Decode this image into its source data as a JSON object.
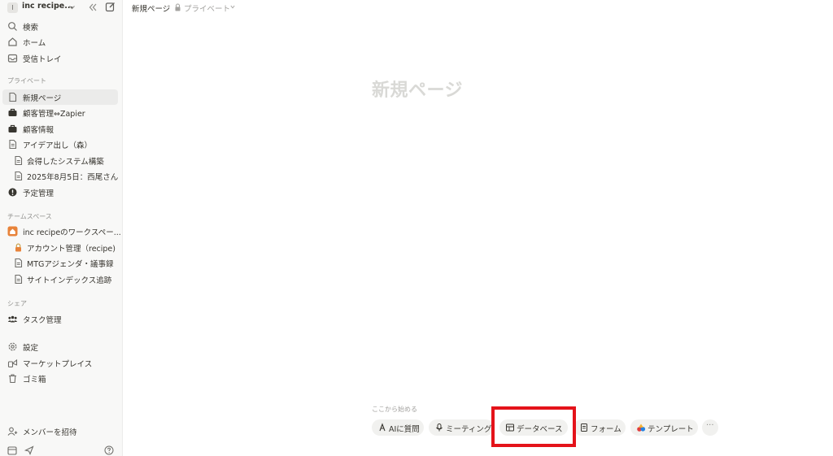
{
  "workspace": {
    "badge": "I",
    "name": "inc recipe..."
  },
  "sidebar": {
    "top_items": [
      {
        "label": "検索",
        "icon": "search-icon"
      },
      {
        "label": "ホーム",
        "icon": "home-icon"
      },
      {
        "label": "受信トレイ",
        "icon": "inbox-icon"
      }
    ],
    "private_label": "プライベート",
    "private_items": [
      {
        "label": "新規ページ",
        "icon": "page-icon"
      },
      {
        "label": "顧客管理⇔Zapier",
        "icon": "briefcase-icon"
      },
      {
        "label": "顧客情報",
        "icon": "briefcase-icon"
      },
      {
        "label": "アイデア出し（森）",
        "icon": "page-icon"
      },
      {
        "label": "会得したシステム構築",
        "icon": "page-icon"
      },
      {
        "label": "2025年8月5日：西尾さん",
        "icon": "page-icon"
      },
      {
        "label": "予定管理",
        "icon": "alert-icon"
      }
    ],
    "team_label": "チームスペース",
    "team_items": [
      {
        "label": "inc recipeのワークスペー...",
        "icon": "house-icon"
      },
      {
        "label": "アカウント管理（recipe)",
        "icon": "lock-icon"
      },
      {
        "label": "MTGアジェンダ・議事録",
        "icon": "page-icon"
      },
      {
        "label": "サイトインデックス追跡",
        "icon": "page-icon"
      }
    ],
    "shared_label": "シェア",
    "shared_items": [
      {
        "label": "タスク管理",
        "icon": "people-icon"
      }
    ],
    "bottom_items": [
      {
        "label": "設定",
        "icon": "gear-icon"
      },
      {
        "label": "マーケットプレイス",
        "icon": "marketplace-icon"
      },
      {
        "label": "ゴミ箱",
        "icon": "trash-icon"
      }
    ],
    "invite_label": "メンバーを招待"
  },
  "breadcrumb": {
    "title": "新規ページ",
    "privacy": "プライベート"
  },
  "page": {
    "title": "新規ページ",
    "start_label": "ここから始める",
    "chips": [
      {
        "label": "AIに質問",
        "icon": "ai-icon"
      },
      {
        "label": "ミーティング",
        "icon": "microphone-icon"
      },
      {
        "label": "データベース",
        "icon": "table-icon"
      },
      {
        "label": "フォーム",
        "icon": "form-icon"
      },
      {
        "label": "テンプレート",
        "icon": "template-icon"
      }
    ],
    "more_label": "···"
  },
  "colors": {
    "highlight": "#e4131a",
    "sidebar_bg": "#f8f8f7",
    "text": "#37352f",
    "muted": "#91918e",
    "team_accent": "#e8833a"
  }
}
